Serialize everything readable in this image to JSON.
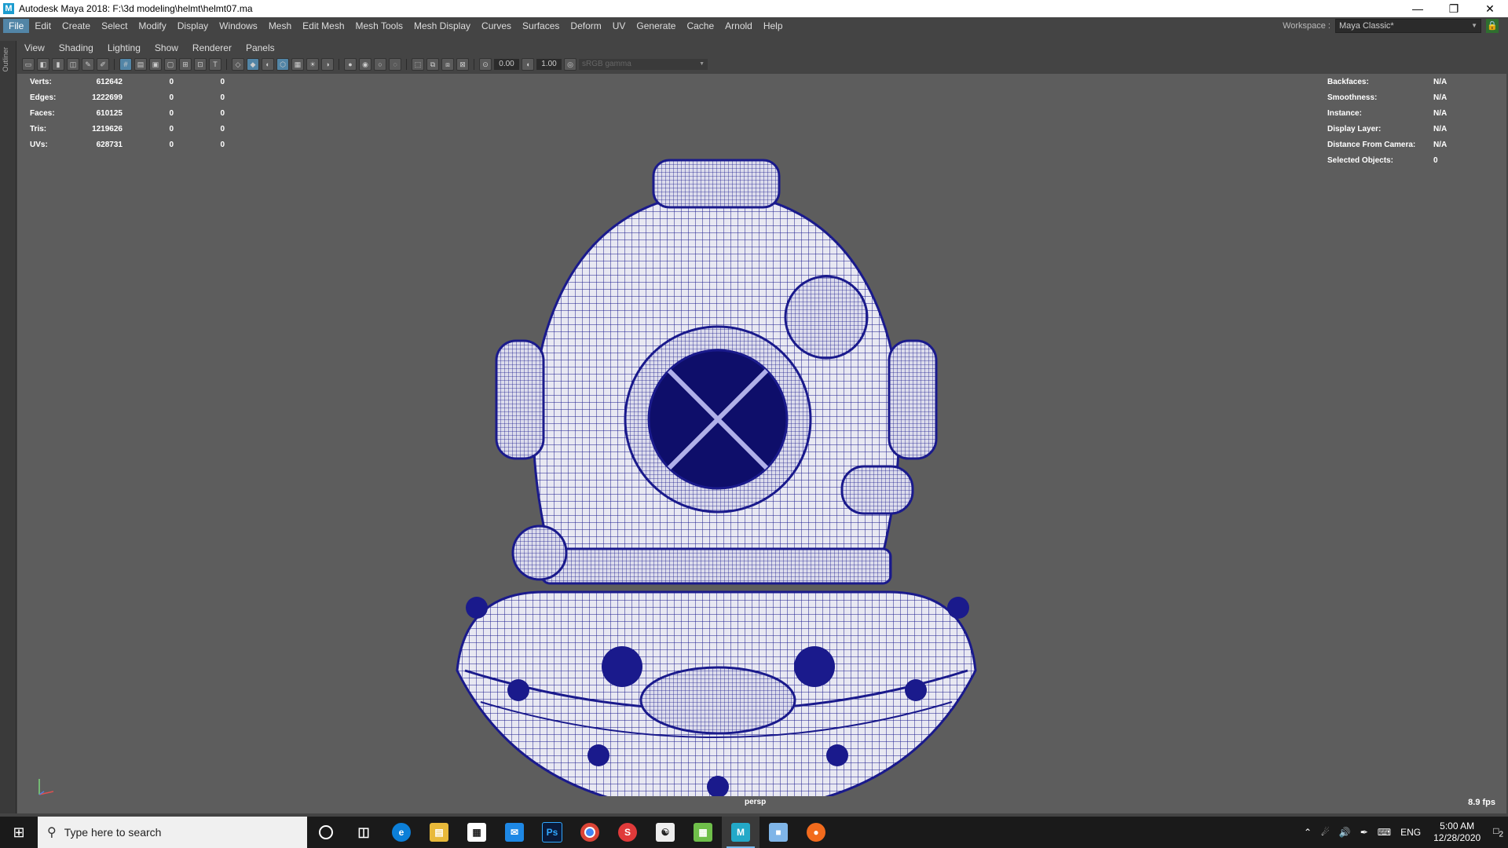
{
  "window": {
    "title": "Autodesk Maya 2018: F:\\3d modeling\\helmt\\helmt07.ma",
    "app_icon": "M"
  },
  "menubar": {
    "items": [
      "File",
      "Edit",
      "Create",
      "Select",
      "Modify",
      "Display",
      "Windows",
      "Mesh",
      "Edit Mesh",
      "Mesh Tools",
      "Mesh Display",
      "Curves",
      "Surfaces",
      "Deform",
      "UV",
      "Generate",
      "Cache",
      "Arnold",
      "Help"
    ],
    "active": "File",
    "workspace_label": "Workspace :",
    "workspace_value": "Maya Classic*"
  },
  "sidebar": {
    "outliner_label": "Outliner"
  },
  "panel_menu": [
    "View",
    "Shading",
    "Lighting",
    "Show",
    "Renderer",
    "Panels"
  ],
  "toolbar": {
    "field_a": "0.00",
    "field_b": "1.00",
    "color_space": "sRGB gamma"
  },
  "hud_left": {
    "rows": [
      {
        "label": "Verts:",
        "value": "612642",
        "c1": "0",
        "c2": "0"
      },
      {
        "label": "Edges:",
        "value": "1222699",
        "c1": "0",
        "c2": "0"
      },
      {
        "label": "Faces:",
        "value": "610125",
        "c1": "0",
        "c2": "0"
      },
      {
        "label": "Tris:",
        "value": "1219626",
        "c1": "0",
        "c2": "0"
      },
      {
        "label": "UVs:",
        "value": "628731",
        "c1": "0",
        "c2": "0"
      }
    ]
  },
  "hud_right": {
    "rows": [
      {
        "label": "Backfaces:",
        "value": "N/A"
      },
      {
        "label": "Smoothness:",
        "value": "N/A"
      },
      {
        "label": "Instance:",
        "value": "N/A"
      },
      {
        "label": "Display Layer:",
        "value": "N/A"
      },
      {
        "label": "Distance From Camera:",
        "value": "N/A"
      },
      {
        "label": "Selected Objects:",
        "value": "0"
      }
    ]
  },
  "viewport": {
    "camera": "persp",
    "fps": "8.9 fps",
    "wire_color": "#1a1a8c"
  },
  "taskbar": {
    "search_placeholder": "Type here to search",
    "language": "ENG",
    "time": "5:00 AM",
    "date": "12/28/2020",
    "notification_count": "2"
  }
}
